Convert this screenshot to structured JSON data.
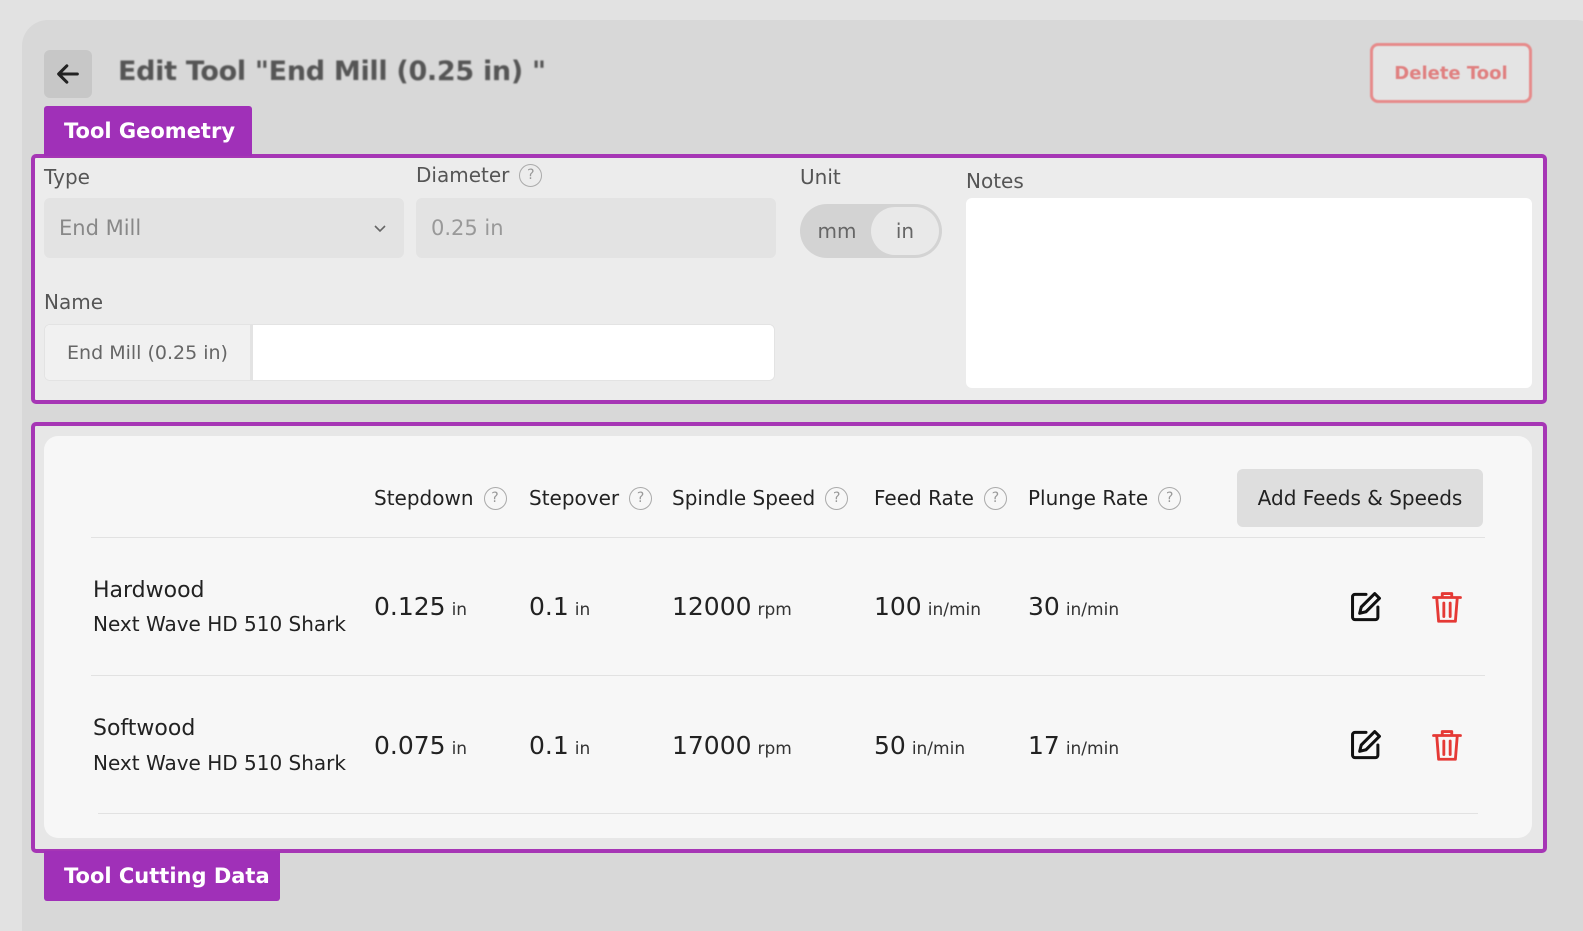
{
  "header": {
    "title": "Edit Tool \"End Mill (0.25 in) \"",
    "delete_label": "Delete Tool"
  },
  "tabs": {
    "geometry": "Tool Geometry",
    "cutting": "Tool Cutting Data"
  },
  "geometry": {
    "type_label": "Type",
    "type_value": "End Mill",
    "diameter_label": "Diameter",
    "diameter_placeholder": "0.25 in",
    "unit_label": "Unit",
    "unit_options": [
      "mm",
      "in"
    ],
    "unit_selected": "in",
    "notes_label": "Notes",
    "notes_value": "",
    "name_label": "Name",
    "name_prefix": "End Mill (0.25 in)",
    "name_value": ""
  },
  "cutting": {
    "columns": [
      "Stepdown",
      "Stepover",
      "Spindle Speed",
      "Feed Rate",
      "Plunge Rate"
    ],
    "add_label": "Add Feeds & Speeds",
    "rows": [
      {
        "material": "Hardwood",
        "machine": "Next Wave HD 510 Shark",
        "stepdown": "0.125",
        "stepdown_unit": "in",
        "stepover": "0.1",
        "stepover_unit": "in",
        "spindle": "12000",
        "spindle_unit": "rpm",
        "feed": "100",
        "feed_unit": "in/min",
        "plunge": "30",
        "plunge_unit": "in/min"
      },
      {
        "material": "Softwood",
        "machine": "Next Wave HD 510 Shark",
        "stepdown": "0.075",
        "stepdown_unit": "in",
        "stepover": "0.1",
        "stepover_unit": "in",
        "spindle": "17000",
        "spindle_unit": "rpm",
        "feed": "50",
        "feed_unit": "in/min",
        "plunge": "17",
        "plunge_unit": "in/min"
      }
    ]
  },
  "colors": {
    "accent": "#a636b5",
    "danger": "#e53935"
  },
  "icons": {
    "back": "arrow-left-icon",
    "help": "question-circle-icon",
    "select": "chevron-down-icon",
    "edit": "edit-icon",
    "delete": "trash-icon"
  }
}
